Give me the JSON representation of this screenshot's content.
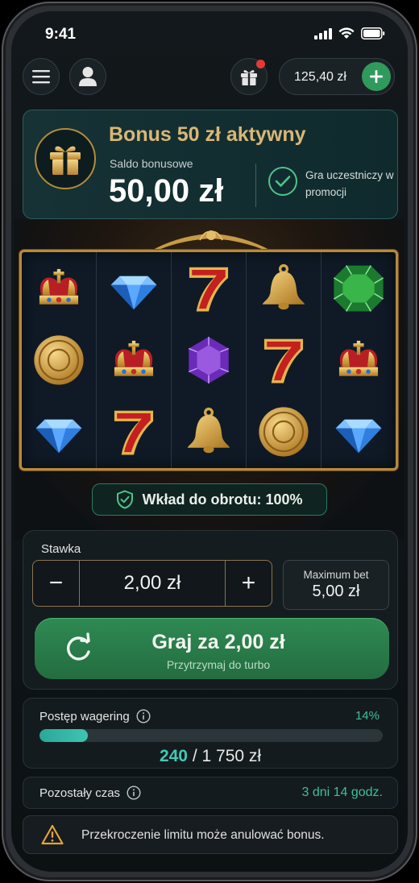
{
  "status_bar": {
    "time": "9:41"
  },
  "header": {
    "balance": "125,40 zł"
  },
  "bonus": {
    "title": "Bonus 50 zł aktywny",
    "balance_label": "Saldo bonusowe",
    "balance_amount": "50,00 zł",
    "participation": "Gra uczestniczy w promocji"
  },
  "slot": {
    "reels": [
      [
        "crown",
        "coin",
        "diamond"
      ],
      [
        "diamond",
        "crown",
        "seven"
      ],
      [
        "seven",
        "amethyst",
        "bell"
      ],
      [
        "bell",
        "seven",
        "coin"
      ],
      [
        "emerald",
        "crown",
        "diamond"
      ]
    ],
    "contribution": "Wkład do obrotu: 100%"
  },
  "bet": {
    "label": "Stawka",
    "value": "2,00 zł",
    "minus": "−",
    "plus": "+",
    "max_label": "Maximum bet",
    "max_value": "5,00 zł",
    "play_title": "Graj za 2,00 zł",
    "play_sub": "Przytrzymaj do turbo"
  },
  "wagering": {
    "label": "Postęp wagering",
    "percent_text": "14%",
    "progress_fraction": 0.14,
    "current": "240",
    "separator": " / ",
    "total": "1 750 zł"
  },
  "time_left": {
    "label": "Pozostały czas",
    "value": "3 dni 14 godz."
  },
  "warning": {
    "text": "Przekroczenie limitu może anulować bonus."
  },
  "colors": {
    "accent_green": "#2f9a5c",
    "gold": "#d9b776",
    "teal": "#3dbf9a"
  }
}
